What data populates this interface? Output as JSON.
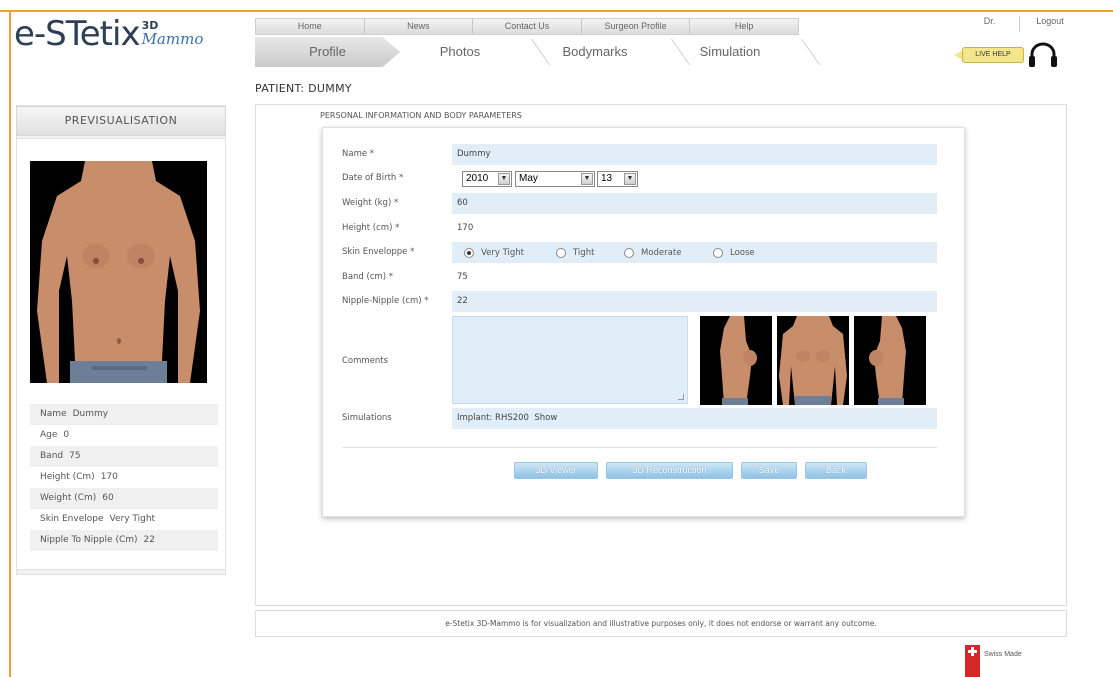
{
  "brand": {
    "logo_main": "e-STetix",
    "logo_3d": "3D",
    "logo_mammo": "Mammo",
    "accent": "#f0a030"
  },
  "top_nav": [
    "Home",
    "News",
    "Contact Us",
    "Surgeon Profile",
    "Help"
  ],
  "user_menu": {
    "user": "Dr.",
    "logout": "Logout"
  },
  "steps": [
    "Profile",
    "Photos",
    "Bodymarks",
    "Simulation"
  ],
  "active_step": "Profile",
  "live_help": "LIVE HELP",
  "patient_title": "PATIENT: DUMMY",
  "left_panel": {
    "heading": "PREVISUALISATION",
    "info": [
      {
        "key": "Name",
        "value": "Dummy"
      },
      {
        "key": "Age",
        "value": "0"
      },
      {
        "key": "Band",
        "value": "75"
      },
      {
        "key": "Height (Cm)",
        "value": "170"
      },
      {
        "key": "Weight (Cm)",
        "value": "60"
      },
      {
        "key": "Skin Envelope",
        "value": "Very Tight"
      },
      {
        "key": "Nipple To Nipple (Cm)",
        "value": "22"
      }
    ]
  },
  "form": {
    "section_title": "PERSONAL INFORMATION AND BODY PARAMETERS",
    "name": {
      "label": "Name *",
      "value": "Dummy"
    },
    "dob": {
      "label": "Date of Birth *",
      "year": "2010",
      "month": "May",
      "day": "13"
    },
    "weight": {
      "label": "Weight (kg) *",
      "value": "60"
    },
    "height": {
      "label": "Height (cm) *",
      "value": "170"
    },
    "skin": {
      "label": "Skin Enveloppe *",
      "options": [
        "Very Tight",
        "Tight",
        "Moderate",
        "Loose"
      ],
      "selected": "Very Tight"
    },
    "band": {
      "label": "Band (cm) *",
      "value": "75"
    },
    "nipple": {
      "label": "Nipple-Nipple (cm) *",
      "value": "22"
    },
    "comments": {
      "label": "Comments",
      "value": ""
    },
    "simulations": {
      "label": "Simulations",
      "value": "Implant: RHS200",
      "link": "Show"
    }
  },
  "buttons": {
    "viewer": "3D Viewer",
    "reconstruction": "3D Reconstruction",
    "save": "Save",
    "back": "Back"
  },
  "footer": "e-Stetix 3D-Mammo is for visualization and illustrative purposes only, it does not endorse or warrant any outcome.",
  "swiss_made": "Swiss Made"
}
